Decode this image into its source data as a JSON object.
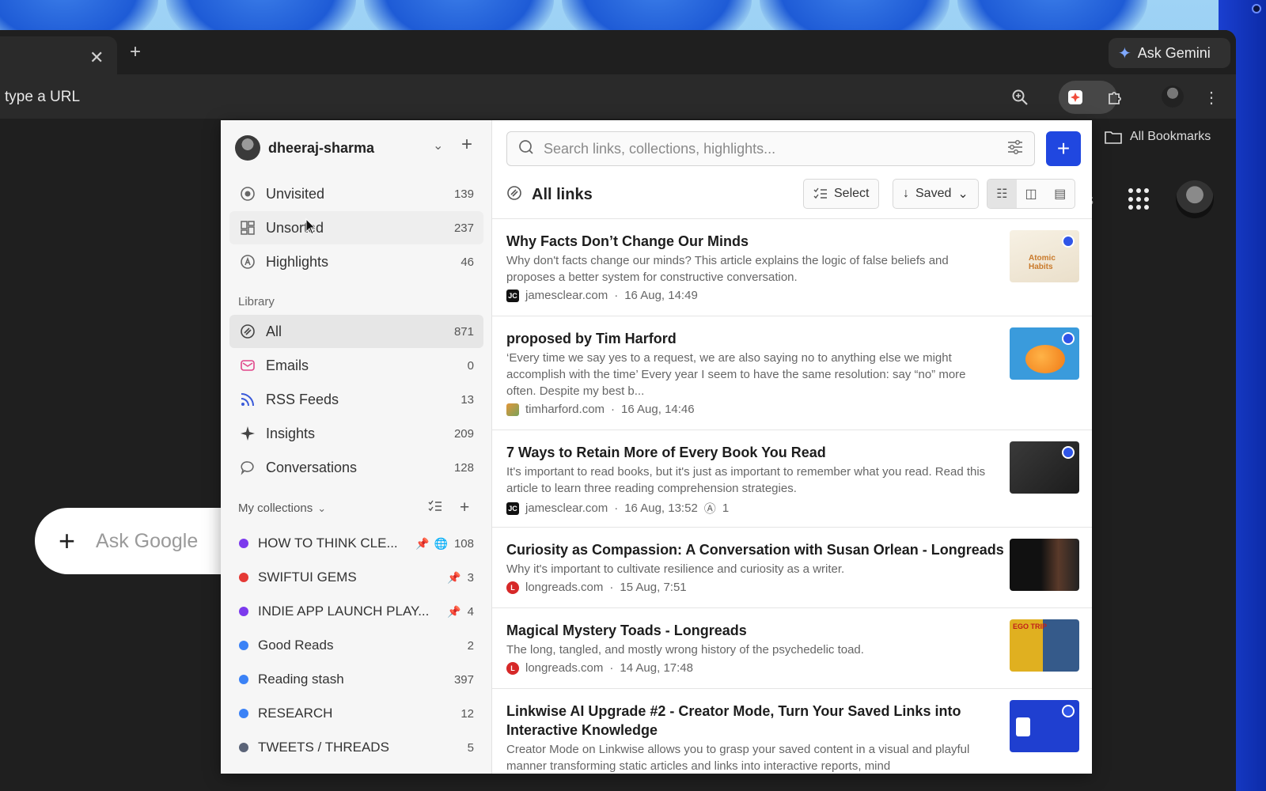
{
  "browser": {
    "ask_gemini": "Ask Gemini",
    "url_placeholder": "type a URL",
    "all_bookmarks": "All Bookmarks",
    "ask_google": "Ask Google",
    "partial_text": "s"
  },
  "sidebar": {
    "account": "dheeraj-sharma",
    "top_items": [
      {
        "label": "Unvisited",
        "count": "139"
      },
      {
        "label": "Unsorted",
        "count": "237"
      },
      {
        "label": "Highlights",
        "count": "46"
      }
    ],
    "library_label": "Library",
    "library_items": [
      {
        "label": "All",
        "count": "871"
      },
      {
        "label": "Emails",
        "count": "0"
      },
      {
        "label": "RSS Feeds",
        "count": "13"
      },
      {
        "label": "Insights",
        "count": "209"
      },
      {
        "label": "Conversations",
        "count": "128"
      }
    ],
    "collections_label": "My collections",
    "collections": [
      {
        "label": "HOW TO THINK CLE...",
        "count": "108",
        "color": "#7c3aed"
      },
      {
        "label": "SWIFTUI GEMS",
        "count": "3",
        "color": "#e53935"
      },
      {
        "label": "INDIE APP LAUNCH PLAY...",
        "count": "4",
        "color": "#7c3aed"
      },
      {
        "label": "Good Reads",
        "count": "2",
        "color": "#3b82f6"
      },
      {
        "label": "Reading stash",
        "count": "397",
        "color": "#3b82f6"
      },
      {
        "label": "RESEARCH",
        "count": "12",
        "color": "#3b82f6"
      },
      {
        "label": "TWEETS / THREADS",
        "count": "5",
        "color": "#5b6478"
      }
    ]
  },
  "main": {
    "search_placeholder": "Search links, collections, highlights...",
    "title": "All links",
    "select_label": "Select",
    "sort_label": "Saved",
    "links": [
      {
        "title": "Why Facts Don’t Change Our Minds",
        "desc": "Why don't facts change our minds? This article explains the logic of false beliefs and proposes a better system for constructive conversation.",
        "domain": "jamesclear.com",
        "date": "16 Aug, 14:49",
        "fav": "JC"
      },
      {
        "title": "proposed by Tim Harford",
        "desc": "‘Every time we say yes to a request, we are also saying no to anything else we might accomplish with the time’ Every year I seem to have the same resolution: say “no” more often. Despite my best b...",
        "domain": "timharford.com",
        "date": "16 Aug, 14:46",
        "fav": ""
      },
      {
        "title": "7 Ways to Retain More of Every Book You Read",
        "desc": "It's important to read books, but it's just as important to remember what you read. Read this article to learn three reading comprehension strategies.",
        "domain": "jamesclear.com",
        "date": "16 Aug, 13:52",
        "fav": "JC",
        "highlights": "1"
      },
      {
        "title": "Curiosity as Compassion: A Conversation with Susan Orlean - Longreads",
        "desc": "Why it's important to cultivate resilience and curiosity as a writer.",
        "domain": "longreads.com",
        "date": "15 Aug, 7:51",
        "fav": "L"
      },
      {
        "title": "Magical Mystery Toads - Longreads",
        "desc": "The long, tangled, and mostly wrong history of the psychedelic toad.",
        "domain": "longreads.com",
        "date": "14 Aug, 17:48",
        "fav": "L"
      },
      {
        "title": "Linkwise AI Upgrade #2 - Creator Mode, Turn Your Saved Links into Interactive Knowledge",
        "desc": "Creator Mode on Linkwise allows you to grasp your saved content in a visual and playful manner transforming static articles and links into interactive reports, mind",
        "domain": "",
        "date": "",
        "fav": ""
      }
    ],
    "thumb_texts": {
      "t1": "Atomic Habits",
      "t5": "EGO TRIP"
    }
  }
}
